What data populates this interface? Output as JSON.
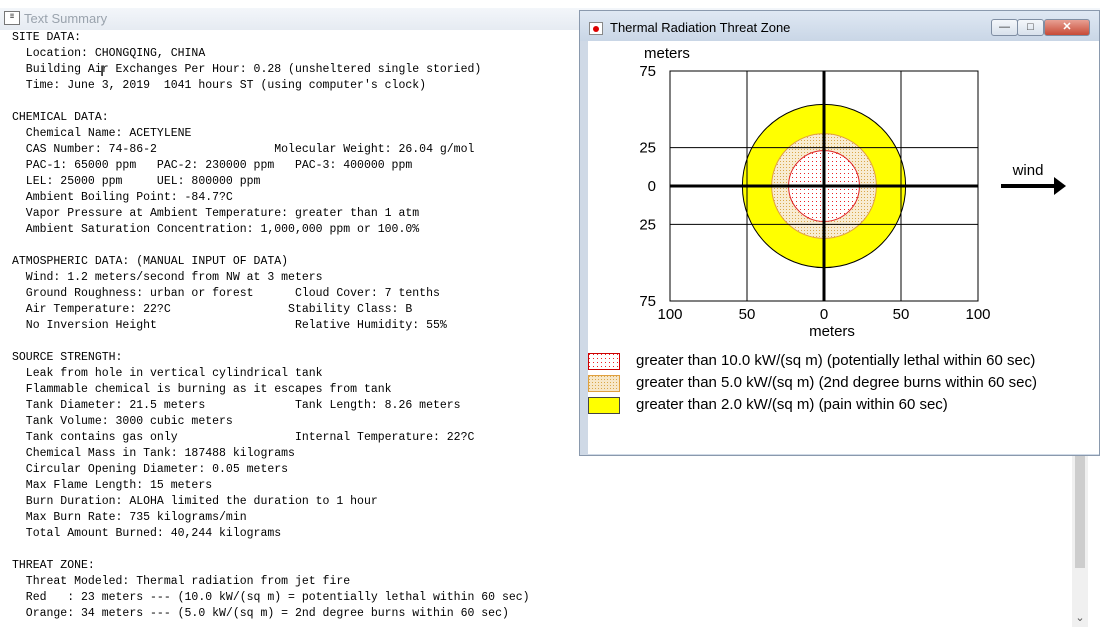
{
  "text_summary": {
    "title": "Text Summary",
    "icon": "document-icon",
    "lines": [
      "SITE DATA:",
      "  Location: CHONGQING, CHINA",
      "  Building Air Exchanges Per Hour: 0.28 (unsheltered single storied)",
      "  Time: June 3, 2019  1041 hours ST (using computer's clock)",
      "",
      "CHEMICAL DATA:",
      "  Chemical Name: ACETYLENE",
      "  CAS Number: 74-86-2                 Molecular Weight: 26.04 g/mol",
      "  PAC-1: 65000 ppm   PAC-2: 230000 ppm   PAC-3: 400000 ppm",
      "  LEL: 25000 ppm     UEL: 800000 ppm",
      "  Ambient Boiling Point: -84.7?C",
      "  Vapor Pressure at Ambient Temperature: greater than 1 atm",
      "  Ambient Saturation Concentration: 1,000,000 ppm or 100.0%",
      "",
      "ATMOSPHERIC DATA: (MANUAL INPUT OF DATA)",
      "  Wind: 1.2 meters/second from NW at 3 meters",
      "  Ground Roughness: urban or forest      Cloud Cover: 7 tenths",
      "  Air Temperature: 22?C                 Stability Class: B",
      "  No Inversion Height                    Relative Humidity: 55%",
      "",
      "SOURCE STRENGTH:",
      "  Leak from hole in vertical cylindrical tank",
      "  Flammable chemical is burning as it escapes from tank",
      "  Tank Diameter: 21.5 meters             Tank Length: 8.26 meters",
      "  Tank Volume: 3000 cubic meters",
      "  Tank contains gas only                 Internal Temperature: 22?C",
      "  Chemical Mass in Tank: 187488 kilograms",
      "  Circular Opening Diameter: 0.05 meters",
      "  Max Flame Length: 15 meters",
      "  Burn Duration: ALOHA limited the duration to 1 hour",
      "  Max Burn Rate: 735 kilograms/min",
      "  Total Amount Burned: 40,244 kilograms",
      "",
      "THREAT ZONE:",
      "  Threat Modeled: Thermal radiation from jet fire",
      "  Red   : 23 meters --- (10.0 kW/(sq m) = potentially lethal within 60 sec)",
      "  Orange: 34 meters --- (5.0 kW/(sq m) = 2nd degree burns within 60 sec)"
    ]
  },
  "threat_window": {
    "title": "Thermal Radiation Threat Zone",
    "icon": "threat-zone-app-icon",
    "buttons": {
      "minimize": "minimize-icon",
      "maximize": "maximize-icon",
      "close": "close-icon"
    }
  },
  "chart_data": {
    "type": "threat-zone-plot",
    "axis_unit_label_top": "meters",
    "axis_unit_label_bottom": "meters",
    "y_ticks": [
      "75",
      "25",
      "0",
      "25",
      "75"
    ],
    "y_tick_values": [
      75,
      25,
      0,
      -25,
      -75
    ],
    "x_ticks": [
      "100",
      "50",
      "0",
      "50",
      "100"
    ],
    "x_tick_values": [
      -100,
      -50,
      0,
      50,
      100
    ],
    "xlim": [
      -100,
      100
    ],
    "ylim": [
      -75,
      75
    ],
    "grid": true,
    "wind_label": "wind",
    "zones": [
      {
        "name": "red",
        "radius": 23,
        "color": "#dd2222",
        "fill": "dotted",
        "label": "greater than 10.0 kW/(sq m) (potentially lethal within 60 sec)"
      },
      {
        "name": "orange",
        "radius": 34,
        "color": "#e0a040",
        "fill": "stippled",
        "label": "greater than 5.0 kW/(sq m) (2nd degree burns within 60 sec)"
      },
      {
        "name": "yellow",
        "radius": 53,
        "color": "#ffff00",
        "fill": "solid",
        "label": "greater than 2.0 kW/(sq m) (pain within 60 sec)"
      }
    ]
  }
}
